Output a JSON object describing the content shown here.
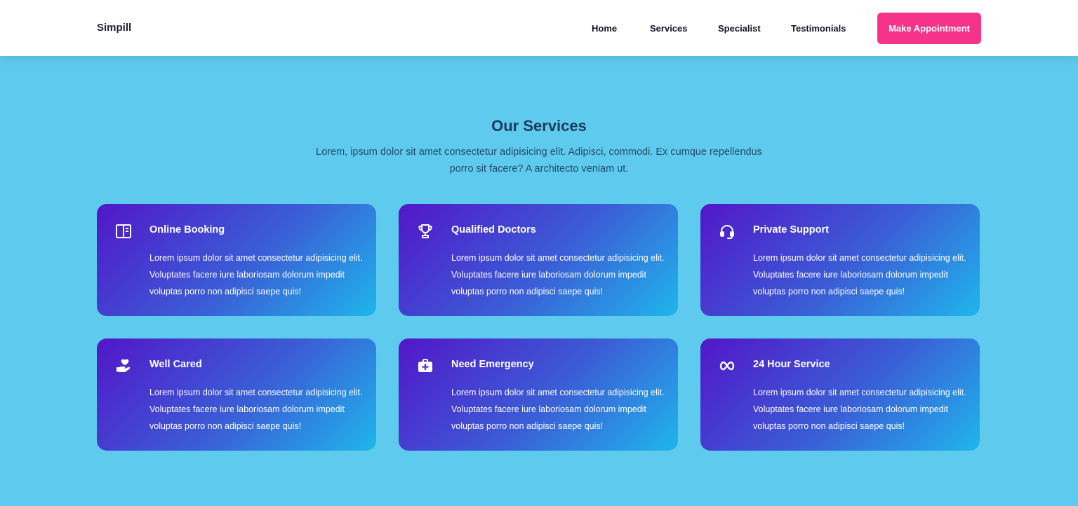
{
  "brand": "Simpill",
  "nav": {
    "links": [
      "Home",
      "Services",
      "Specialist",
      "Testimonials"
    ],
    "cta": "Make Appointment"
  },
  "colors": {
    "background": "#5ecbee",
    "cta": "#f6338b",
    "card_gradient_start": "#5216c9",
    "card_gradient_end": "#1fb6ec"
  },
  "services": {
    "title": "Our Services",
    "description": "Lorem, ipsum dolor sit amet consectetur adipisicing elit. Adipisci, commodi. Ex cumque repellendus porro sit facere? A architecto veniam ut.",
    "cards": [
      {
        "icon": "book-open-icon",
        "title": "Online Booking",
        "text": "Lorem ipsum dolor sit amet consectetur adipisicing elit. Voluptates facere iure laboriosam dolorum impedit voluptas porro non adipisci saepe quis!"
      },
      {
        "icon": "trophy-icon",
        "title": "Qualified Doctors",
        "text": "Lorem ipsum dolor sit amet consectetur adipisicing elit. Voluptates facere iure laboriosam dolorum impedit voluptas porro non adipisci saepe quis!"
      },
      {
        "icon": "headset-icon",
        "title": "Private Support",
        "text": "Lorem ipsum dolor sit amet consectetur adipisicing elit. Voluptates facere iure laboriosam dolorum impedit voluptas porro non adipisci saepe quis!"
      },
      {
        "icon": "hand-heart-icon",
        "title": "Well Cared",
        "text": "Lorem ipsum dolor sit amet consectetur adipisicing elit. Voluptates facere iure laboriosam dolorum impedit voluptas porro non adipisci saepe quis!"
      },
      {
        "icon": "medical-kit-icon",
        "title": "Need Emergency",
        "text": "Lorem ipsum dolor sit amet consectetur adipisicing elit. Voluptates facere iure laboriosam dolorum impedit voluptas porro non adipisci saepe quis!"
      },
      {
        "icon": "infinity-icon",
        "title": "24 Hour Service",
        "text": "Lorem ipsum dolor sit amet consectetur adipisicing elit. Voluptates facere iure laboriosam dolorum impedit voluptas porro non adipisci saepe quis!"
      }
    ]
  }
}
